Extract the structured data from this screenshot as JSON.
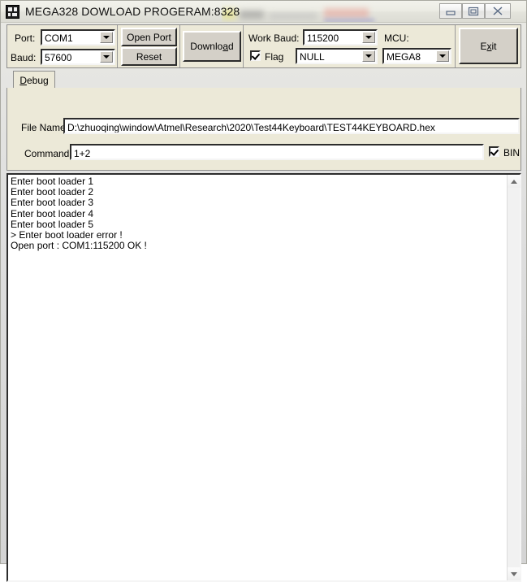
{
  "window": {
    "title": "MEGA328 DOWLOAD PROGERAM:8328",
    "icon": "chip-icon",
    "minimize_label": "minimize-icon",
    "maximize_label": "maximize-icon",
    "close_label": "close-icon"
  },
  "toolbar": {
    "port_label": "Port:",
    "port_value": "COM1",
    "baud_label": "Baud:",
    "baud_value": "57600",
    "open_port_label": "Open Port",
    "reset_label": "Reset",
    "download_label_pre": "Downlo",
    "download_label_accel": "a",
    "download_label_post": "d",
    "work_baud_label": "Work Baud:",
    "work_baud_value": "115200",
    "flag_label": "Flag",
    "flag_checked": true,
    "flag_mode_value": "NULL",
    "mcu_label": "MCU:",
    "mcu_value": "MEGA8",
    "exit_label_pre": "E",
    "exit_label_accel": "x",
    "exit_label_post": "it"
  },
  "tabs": {
    "debug_label_accel": "D",
    "debug_label_rest": "ebug"
  },
  "fields": {
    "file_name_label": "File Name:",
    "file_name_value": "D:\\zhuoqing\\window\\Atmel\\Research\\2020\\Test44Keyboard\\TEST44KEYBOARD.hex",
    "command_label": "Command:",
    "command_value": "1+2",
    "bin_label": "BIN",
    "bin_checked": true
  },
  "log": {
    "text": "Enter boot loader 1\nEnter boot loader 2\nEnter boot loader 3\nEnter boot loader 4\nEnter boot loader 5\n> Enter boot loader error !\nOpen port : COM1:115200 OK !",
    "lines": [
      "Enter boot loader 1",
      "Enter boot loader 2",
      "Enter boot loader 3",
      "Enter boot loader 4",
      "Enter boot loader 5",
      "> Enter boot loader error !",
      "Open port : COM1:115200 OK !"
    ],
    "scroll_up_icon": "scroll-up-arrow",
    "scroll_down_icon": "scroll-down-arrow"
  },
  "colors": {
    "window_chrome": "#e9e9e4",
    "face": "#d4d0c8",
    "panel": "#ece9d8",
    "text": "#000000",
    "field_bg": "#ffffff"
  }
}
